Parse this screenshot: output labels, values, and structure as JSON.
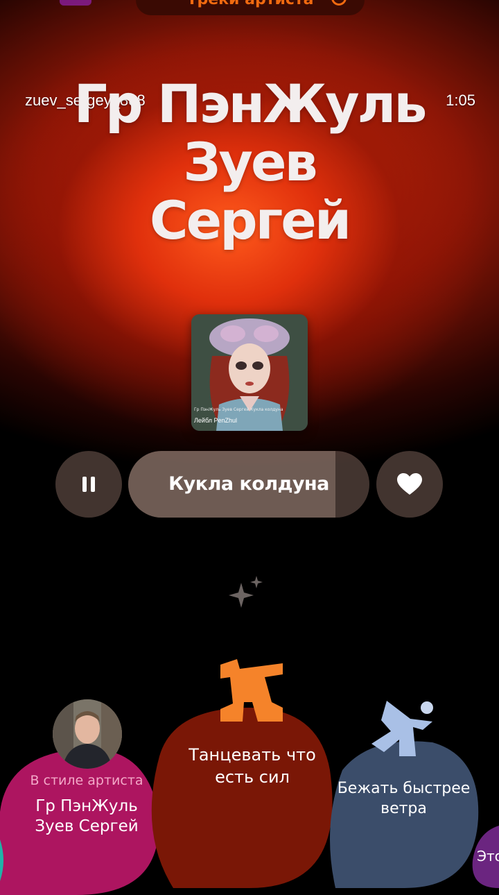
{
  "header": {
    "tab_label": "Треки артиста",
    "username": "zuev_sergey_888",
    "time": "1:05"
  },
  "artist": {
    "title_lines": [
      "Гр ПэнЖуль",
      "Зуев",
      "Сергей"
    ]
  },
  "cover": {
    "caption": "Гр ПэнЖуль Зуев Сергей Кукла колдуна",
    "label": "Лейбл PenZhul"
  },
  "player": {
    "track_name": "Кукла колдуна",
    "progress": 0.86
  },
  "cards": [
    {
      "subtitle": "В стиле артиста",
      "title": "Гр ПэнЖуль Зуев Сергей",
      "color": "#c0176a"
    },
    {
      "title": "Танцевать что есть сил",
      "color": "#8a1a08"
    },
    {
      "title": "Бежать быстрее ветра",
      "color": "#3c5070"
    },
    {
      "title": "Это",
      "color": "#7a2a8a"
    }
  ],
  "icons": {
    "pause": "pause-icon",
    "like": "heart-icon",
    "sparkle": "sparkle-icon"
  },
  "colors": {
    "accent": "#f06a10",
    "background_glow": "#e0300c"
  }
}
